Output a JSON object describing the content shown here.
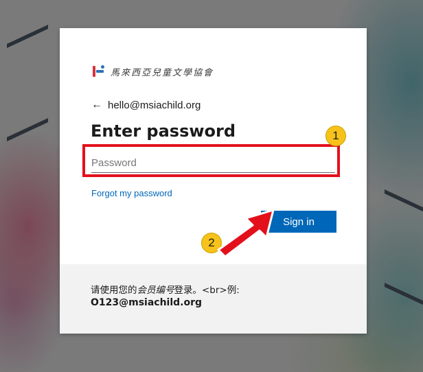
{
  "logo": {
    "org_name": "馬來西亞兒童文學協會"
  },
  "identity": {
    "email": "hello@msiachild.org",
    "back_icon": "arrow-left-icon"
  },
  "form": {
    "title": "Enter password",
    "password_placeholder": "Password",
    "password_value": "",
    "forgot_label": "Forgot my password",
    "signin_label": "Sign in"
  },
  "footer": {
    "text_before": "请使用您的",
    "text_em": "会员编号",
    "text_after": "登录。<br>例:",
    "example": "O123@msiachild.org"
  },
  "annotations": {
    "step1": "1",
    "step2": "2",
    "highlight_color": "#e3101c",
    "badge_color": "#f7c21a"
  },
  "colors": {
    "accent": "#0067b8"
  }
}
